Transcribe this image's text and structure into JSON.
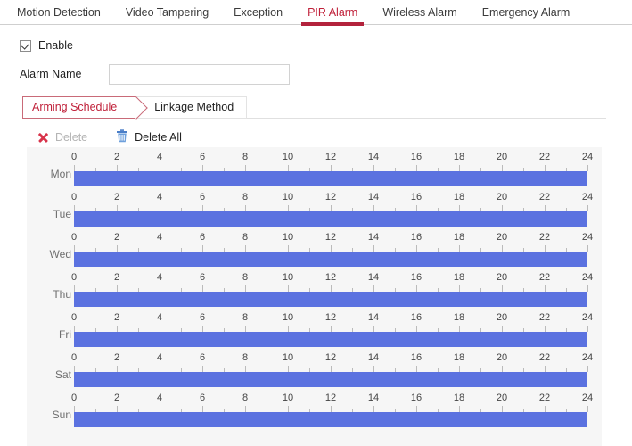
{
  "tabs": [
    {
      "label": "Motion Detection",
      "active": false
    },
    {
      "label": "Video Tampering",
      "active": false
    },
    {
      "label": "Exception",
      "active": false
    },
    {
      "label": "PIR Alarm",
      "active": true
    },
    {
      "label": "Wireless Alarm",
      "active": false
    },
    {
      "label": "Emergency Alarm",
      "active": false
    }
  ],
  "form": {
    "enable_label": "Enable",
    "enable_checked": true,
    "alarm_name_label": "Alarm Name",
    "alarm_name_value": "",
    "alarm_name_placeholder": ""
  },
  "subtabs": [
    {
      "label": "Arming Schedule",
      "active": true
    },
    {
      "label": "Linkage Method",
      "active": false
    }
  ],
  "toolbar": {
    "delete_label": "Delete",
    "delete_enabled": false,
    "delete_all_label": "Delete All",
    "delete_icon": "x-icon",
    "delete_all_icon": "trash-icon"
  },
  "colors": {
    "accent_red": "#c0213a",
    "bar_blue": "#5b72e0",
    "trash_blue": "#4a7ec8",
    "delete_x_red": "#d8344b",
    "panel_bg": "#f6f6f6"
  },
  "schedule": {
    "hour_labels": [
      "0",
      "2",
      "4",
      "6",
      "8",
      "10",
      "12",
      "14",
      "16",
      "18",
      "20",
      "22",
      "24"
    ],
    "axis_min": 0,
    "axis_max": 24,
    "days": [
      {
        "name": "Mon",
        "segments": [
          {
            "start": 0,
            "end": 24
          }
        ]
      },
      {
        "name": "Tue",
        "segments": [
          {
            "start": 0,
            "end": 24
          }
        ]
      },
      {
        "name": "Wed",
        "segments": [
          {
            "start": 0,
            "end": 24
          }
        ]
      },
      {
        "name": "Thu",
        "segments": [
          {
            "start": 0,
            "end": 24
          }
        ]
      },
      {
        "name": "Fri",
        "segments": [
          {
            "start": 0,
            "end": 24
          }
        ]
      },
      {
        "name": "Sat",
        "segments": [
          {
            "start": 0,
            "end": 24
          }
        ]
      },
      {
        "name": "Sun",
        "segments": [
          {
            "start": 0,
            "end": 24
          }
        ]
      }
    ]
  }
}
